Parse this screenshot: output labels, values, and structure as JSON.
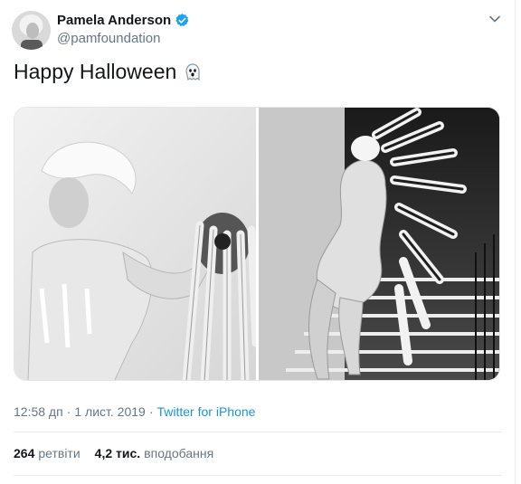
{
  "tweet": {
    "author": {
      "display_name": "Pamela Anderson",
      "handle": "@pamfoundation",
      "verified": true
    },
    "text": "Happy Halloween",
    "emoji_icon": "ghost-icon",
    "media": [
      {
        "kind": "photo",
        "description_icon": "photo"
      },
      {
        "kind": "photo",
        "description_icon": "photo"
      }
    ],
    "meta": {
      "time": "12:58 дп",
      "separator": "·",
      "date": "1 лист. 2019",
      "source": "Twitter for iPhone"
    },
    "stats": {
      "retweets_count": "264",
      "retweets_label": "ретвіти",
      "likes_count": "4,2 тис.",
      "likes_label": "вподобання"
    }
  },
  "colors": {
    "accent": "#1b95e0",
    "verified": "#1da1f2",
    "secondary_text": "#657786",
    "primary_text": "#14171a"
  }
}
